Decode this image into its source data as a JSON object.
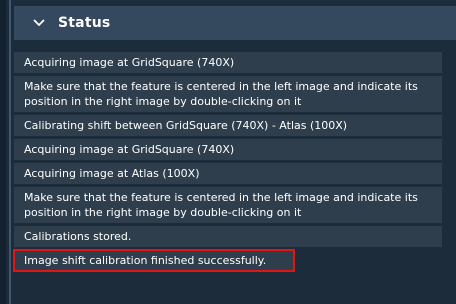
{
  "panel": {
    "title": "Status",
    "toggle_icon": "chevron-down-icon"
  },
  "messages": [
    "Acquiring image at GridSquare (740X)",
    "Make sure that the feature is centered in the left image and indicate its position in the right image by double-clicking on it",
    "Calibrating shift between GridSquare (740X) - Atlas (100X)",
    "Acquiring image at GridSquare (740X)",
    "Acquiring image at Atlas (100X)",
    "Make sure that the feature is centered in the left image and indicate its position in the right image by double-clicking on it",
    "Calibrations stored.",
    "Image shift calibration finished successfully."
  ],
  "colors": {
    "background": "#1d2c3a",
    "header": "#34495e",
    "row": "#2e3e4c",
    "highlight_border": "#e41414"
  }
}
